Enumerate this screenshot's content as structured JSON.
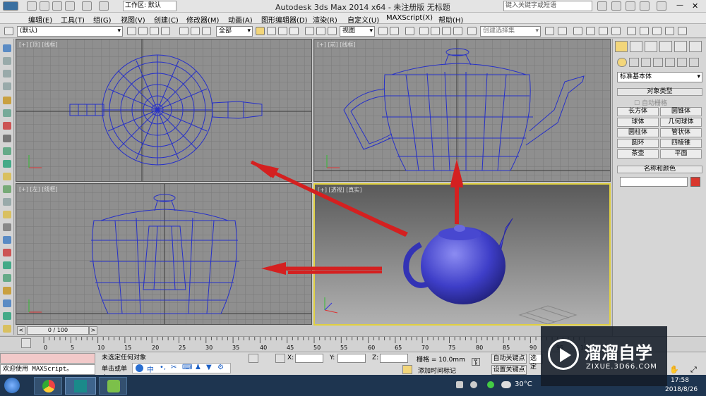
{
  "app": {
    "title": "Autodesk 3ds Max  2014 x64    -  未注册版    无标题",
    "workspace": "工作区: 默认",
    "search_placeholder": "键入关键字或短语"
  },
  "menu": [
    "编辑(E)",
    "工具(T)",
    "组(G)",
    "视图(V)",
    "创建(C)",
    "修改器(M)",
    "动画(A)",
    "图形编辑器(D)",
    "渲染(R)",
    "自定义(U)",
    "MAXScript(X)",
    "帮助(H)"
  ],
  "toolbar": {
    "layer": "(默认)",
    "selection_filter": "全部",
    "ref_coord": "视图",
    "named_selection": "创建选择集"
  },
  "viewports": {
    "top": "[+] [顶] [线框]",
    "front": "[+] [前] [线框]",
    "left": "[+] [左] [线框]",
    "persp": "[+] [透视] [真实]"
  },
  "command_panel": {
    "category": "标准基本体",
    "rollout_object_type": "对象类型",
    "autogrid": "自动栅格",
    "buttons": [
      "长方体",
      "圆锥体",
      "球体",
      "几何球体",
      "圆柱体",
      "管状体",
      "圆环",
      "四棱锥",
      "茶壶",
      "平面"
    ],
    "rollout_name_color": "名称和颜色",
    "object_color": "#d8372d"
  },
  "timeline": {
    "frame": "0 / 100",
    "ticks": [
      "0",
      "5",
      "10",
      "15",
      "20",
      "25",
      "30",
      "35",
      "40",
      "45",
      "50",
      "55",
      "60",
      "65",
      "70",
      "75",
      "80",
      "85",
      "90",
      "95",
      "100"
    ]
  },
  "status": {
    "script_welcome": "欢迎使用 MAXScript。",
    "selection": "未选定任何对象",
    "prompt": "单击或单击",
    "x_label": "X:",
    "y_label": "Y:",
    "z_label": "Z:",
    "grid": "栅格 = 10.0mm",
    "auto_key": "自动关键点",
    "auto_key_mode": "选定",
    "set_key": "设置关键点",
    "add_time_tag": "添加时间标记"
  },
  "ime": {
    "mode": "中"
  },
  "taskbar": {
    "temperature": "30°C",
    "time": "17:58",
    "date": "2018/8/26"
  },
  "watermark": {
    "title": "溜溜自学",
    "url": "ZIXUE.3D66.COM"
  }
}
